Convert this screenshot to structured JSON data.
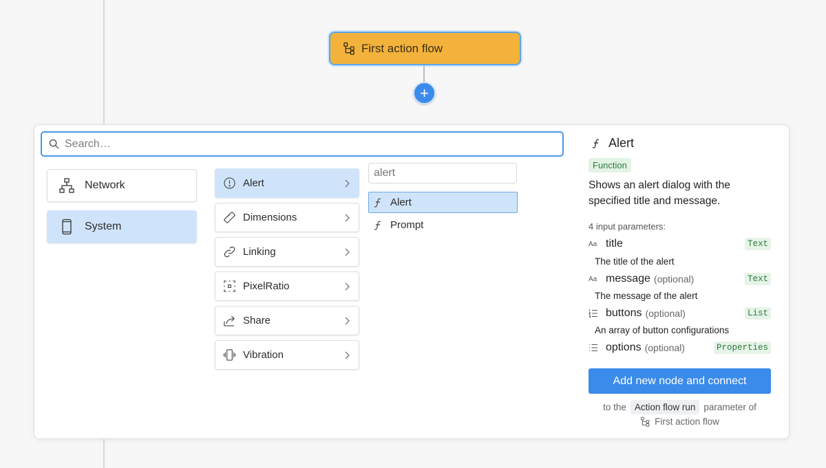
{
  "canvas": {
    "node_label": "First action flow",
    "add_button": "+"
  },
  "search": {
    "placeholder": "Search…",
    "value": ""
  },
  "categories": [
    {
      "label": "Network",
      "icon": "network-icon",
      "selected": false
    },
    {
      "label": "System",
      "icon": "device-icon",
      "selected": true
    }
  ],
  "modules": [
    {
      "label": "Alert",
      "icon": "alert-circle-icon",
      "selected": true
    },
    {
      "label": "Dimensions",
      "icon": "ruler-icon",
      "selected": false
    },
    {
      "label": "Linking",
      "icon": "link-icon",
      "selected": false
    },
    {
      "label": "PixelRatio",
      "icon": "pixel-ratio-icon",
      "selected": false
    },
    {
      "label": "Share",
      "icon": "share-icon",
      "selected": false
    },
    {
      "label": "Vibration",
      "icon": "vibration-icon",
      "selected": false
    }
  ],
  "functions_filter": {
    "placeholder": "alert"
  },
  "functions": [
    {
      "label": "Alert",
      "selected": true
    },
    {
      "label": "Prompt",
      "selected": false
    }
  ],
  "detail": {
    "title": "Alert",
    "badge": "Function",
    "description": "Shows an alert dialog with the specified title and message.",
    "param_count": "4 input parameters:",
    "params": [
      {
        "icon": "text-type-icon",
        "icon_text": "Aa",
        "name": "title",
        "optional": "",
        "type": "Text",
        "description": "The title of the alert"
      },
      {
        "icon": "text-type-icon",
        "icon_text": "Aa",
        "name": "message",
        "optional": "(optional)",
        "type": "Text",
        "description": "The message of the alert"
      },
      {
        "icon": "ordered-list-icon",
        "icon_text": "",
        "name": "buttons",
        "optional": "(optional)",
        "type": "List",
        "description": "An array of button configurations"
      },
      {
        "icon": "properties-list-icon",
        "icon_text": "",
        "name": "options",
        "optional": "(optional)",
        "type": "Properties",
        "description": ""
      }
    ],
    "add_button": "Add new node and connect",
    "note_prefix": "to the",
    "note_chip": "Action flow run",
    "note_suffix": "parameter of",
    "note_target": "First action flow"
  },
  "colors": {
    "accent": "#3b8bea",
    "node": "#f3b23c",
    "selected": "#cfe4fa",
    "badge_bg": "#e3f3e6",
    "badge_fg": "#2e7a3e"
  }
}
